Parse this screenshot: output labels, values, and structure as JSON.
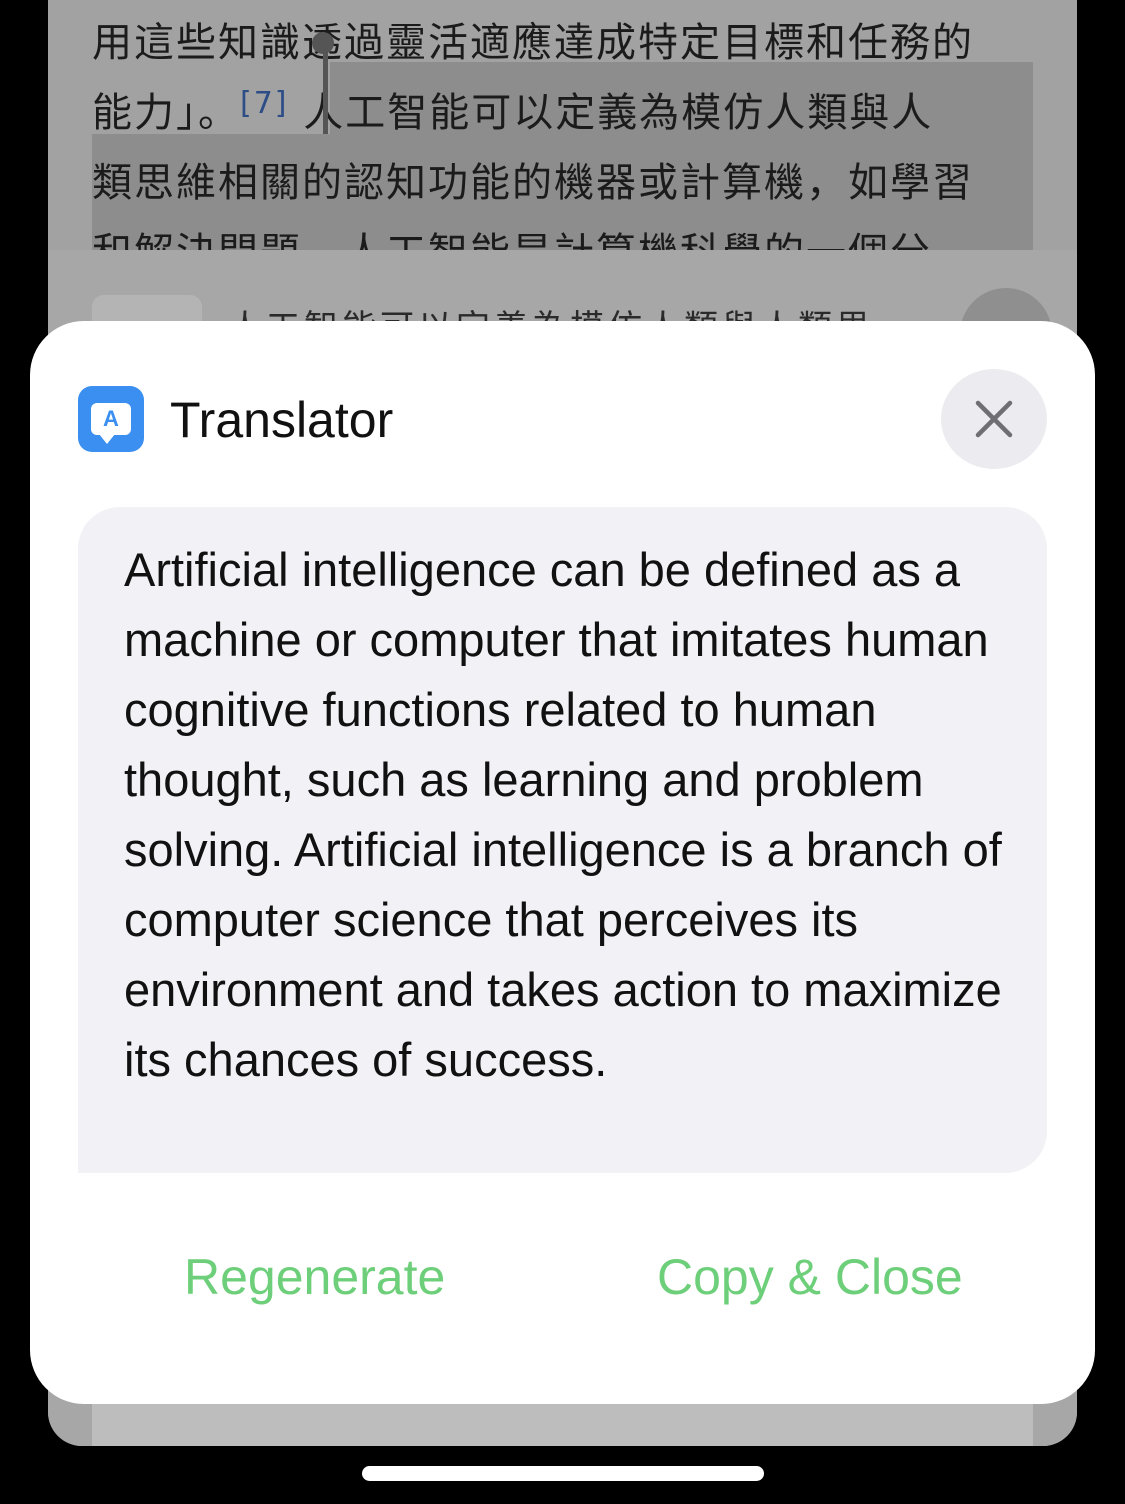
{
  "background": {
    "lines": [
      "用這些知識透過靈活適應達成特定目標和任務的",
      "能力」。",
      "類思維相關的認知功能的機器或計算機，如學習",
      "和解決問題。人工智能是計算機科學的一個分"
    ],
    "line2_ref": "[7]",
    "line2_rest": "人工智能可以定義為模仿人類與人",
    "card_text": "人工智能可以定義為模仿人類與人類思"
  },
  "sheet": {
    "title": "Translator",
    "icon_letter": "A",
    "close_icon": "close-icon",
    "result_text": "Artificial intelligence can be defined as a machine or computer that imitates human cognitive functions related to human thought, such as learning and problem solving. Artificial intelligence is a branch of computer science that perceives its environment and takes action to maximize its chances of success.",
    "actions": {
      "regenerate": "Regenerate",
      "copy_close": "Copy & Close"
    }
  },
  "colors": {
    "accent_green": "#6ecf7a",
    "app_icon_blue": "#3a8ff0",
    "result_bg": "#f1f1f6"
  }
}
